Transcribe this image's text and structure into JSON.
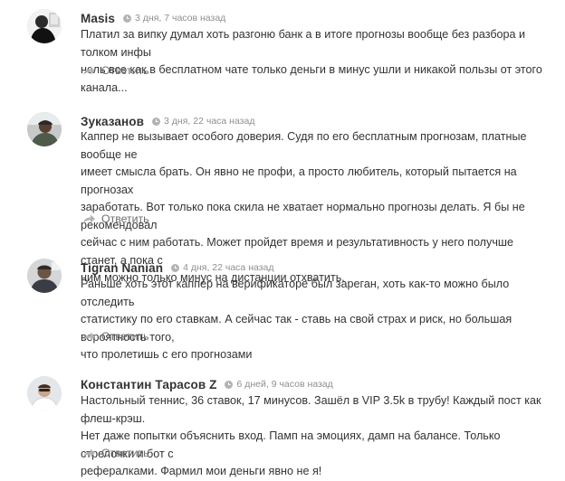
{
  "comments": [
    {
      "author": "Masis",
      "date": "3 дня, 7 часов назад",
      "lines": [
        "Платил за випку думал хоть разгоню банк а в итоге прогнозы вообще без разбора и толком инфы",
        "ноль все как в бесплатном чате только деньги в минус ушли и никакой пользы от этого канала..."
      ],
      "reply_label": "Ответить"
    },
    {
      "author": "Зуказанов",
      "date": "3 дня, 22 часа назад",
      "lines": [
        "Каппер не вызывает особого доверия. Судя по его бесплатным прогнозам, платные вообще не",
        "имеет смысла брать. Он явно не профи, а просто любитель, который пытается на прогнозах",
        "заработать. Вот только пока скила не хватает нормально прогнозы делать. Я бы не рекомендовал",
        "сейчас с ним работать. Может пройдет время и результативность у него получше станет, а пока с",
        "ним можно только минус на дистанции отхватить."
      ],
      "reply_label": "Ответить"
    },
    {
      "author": "Tigran Nanian",
      "date": "4 дня, 22 часа назад",
      "lines": [
        "Раньше хоть этот каппер на верификаторе был зареган, хоть как-то можно было отследить",
        "статистику по его ставкам. А сейчас так - ставь на свой страх и риск, но большая вероятность того,",
        "что пролетишь с его прогнозами"
      ],
      "reply_label": "Ответить"
    },
    {
      "author": "Константин Тарасов Z",
      "date": "6 дней, 9 часов назад",
      "lines": [
        "Настольный теннис, 36 ставок, 17 минусов. Зашёл в VIP 3.5k в трубу! Каждый пост как флеш-крэш.",
        "Нет даже попытки объяснить вход. Памп на эмоциях, дамп на балансе. Только стрелочки и бот с",
        "рефералками. Фармил мои деньги явно не я!"
      ],
      "reply_label": "Ответить"
    }
  ],
  "colors": {
    "text": "#333333",
    "meta": "#8f8f8f",
    "reply": "#6d6d6d",
    "icon": "#b3b3b3"
  },
  "icons": {
    "time": "clock-icon",
    "reply": "reply-arrow-icon"
  }
}
